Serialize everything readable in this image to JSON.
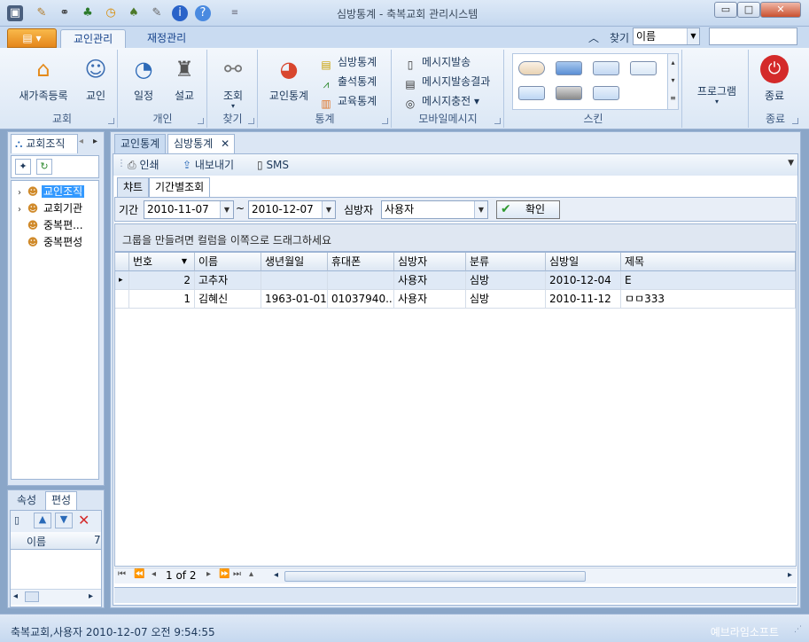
{
  "window": {
    "title": "심방통계 - 축복교회 관리시스템",
    "minimize_glyph": "▭",
    "maximize_glyph": "□",
    "close_glyph": "✕"
  },
  "quick_access": [
    "app-icon",
    "pencil-icon",
    "binoculars-icon",
    "users-icon",
    "clock-icon",
    "tree-icon",
    "wrench-icon",
    "info-icon",
    "help-icon"
  ],
  "ribbon_tabs": {
    "app_button": "▤ ▾",
    "tabs": [
      "교인관리",
      "재정관리"
    ],
    "find_label": "찾기",
    "find_value": "이름",
    "collapse_glyph": "︿"
  },
  "ribbon": {
    "groups": {
      "church": {
        "label": "교회",
        "buttons": [
          "새가족등록",
          "교인"
        ]
      },
      "personal": {
        "label": "개인",
        "buttons": [
          "일정",
          "설교"
        ]
      },
      "find": {
        "label": "찾기",
        "buttons": [
          "조회"
        ]
      },
      "stats": {
        "label": "통계",
        "big": "교인통계",
        "small": [
          "심방통계",
          "출석통계",
          "교육통계"
        ]
      },
      "mobile": {
        "label": "모바일메시지",
        "small": [
          "메시지발송",
          "메시지발송결과",
          "메시지충전 ▾"
        ]
      },
      "skin": {
        "label": "스킨"
      },
      "program": {
        "label": "",
        "buttons": [
          "프로그램"
        ]
      },
      "exit": {
        "label": "종료",
        "buttons": [
          "종료"
        ]
      }
    }
  },
  "left_panel": {
    "tab_label": "교회조직",
    "tree": [
      {
        "label": "교인조직",
        "expand": "›",
        "selected": true
      },
      {
        "label": "교회기관",
        "expand": "›",
        "selected": false
      },
      {
        "label": "중복편...",
        "expand": "",
        "selected": false
      },
      {
        "label": "중복편성",
        "expand": "",
        "selected": false
      }
    ],
    "lower_tabs": [
      "속성",
      "편성"
    ],
    "lower_column": "이름",
    "lower_column2": "7"
  },
  "doc_tabs": [
    "교인통계",
    "심방통계"
  ],
  "toolbar": {
    "print": "인쇄",
    "export": "내보내기",
    "sms": "SMS"
  },
  "sub_tabs": [
    "챠트",
    "기간별조회"
  ],
  "filter": {
    "period_label": "기간",
    "start_date": "2010-11-07",
    "tilde": "~",
    "end_date": "2010-12-07",
    "visitor_label": "심방자",
    "visitor_value": "사용자",
    "confirm_button": "확인"
  },
  "group_hint": "그룹을 만들려면 컬럼을 이쪽으로 드래그하세요",
  "grid": {
    "columns": [
      "번호",
      "이름",
      "생년월일",
      "휴대폰",
      "심방자",
      "분류",
      "심방일",
      "제목"
    ],
    "rows": [
      [
        "2",
        "고추자",
        "",
        "",
        "사용자",
        "심방",
        "2010-12-04",
        "E"
      ],
      [
        "1",
        "김혜신",
        "1963-01-01",
        "01037940...",
        "사용자",
        "심방",
        "2010-11-12",
        "ㅁㅁ333"
      ]
    ],
    "current_row_marker": "▸"
  },
  "pager": {
    "first": "⏮",
    "prev_page": "⏪",
    "prev": "◂",
    "text": "1 of 2",
    "next": "▸",
    "next_page": "⏩",
    "last": "⏭",
    "up": "▴"
  },
  "status": {
    "text": "축복교회,사용자 2010-12-07 오전 9:54:55",
    "right": "예브라임소프트"
  },
  "colors": {
    "accent": "#15428b",
    "selection": "#3399ff",
    "app_button": "#e4861a"
  }
}
